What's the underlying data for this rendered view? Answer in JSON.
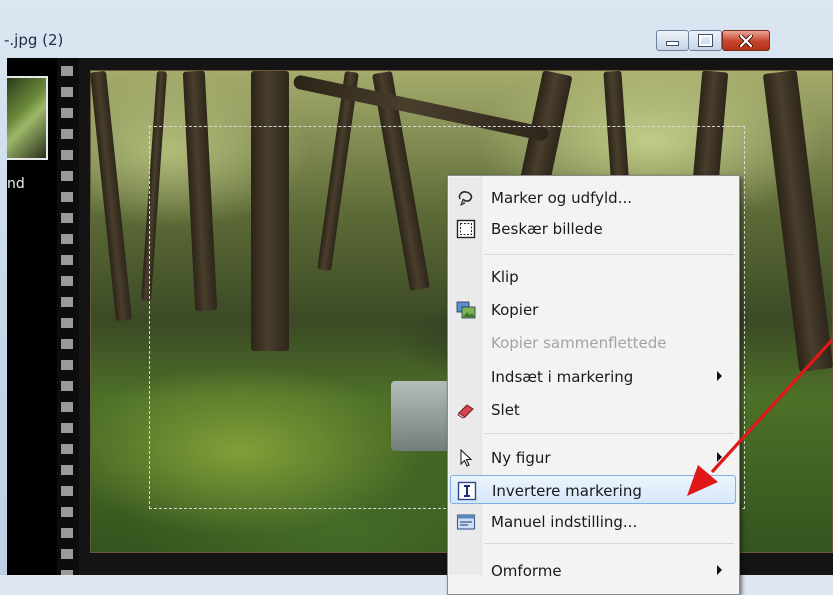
{
  "window": {
    "title": "-.jpg (2)",
    "buttons": {
      "minimize": "minimize",
      "maximize": "maximize",
      "close": "close"
    }
  },
  "thumbnail": {
    "label": "nd"
  },
  "context_menu": {
    "items": [
      {
        "label": "Marker og udfyld...",
        "icon": "lasso-icon",
        "enabled": true
      },
      {
        "label": "Beskær billede",
        "icon": "crop-icon",
        "enabled": true
      },
      {
        "separator": true
      },
      {
        "label": "Klip",
        "icon": "",
        "enabled": true
      },
      {
        "label": "Kopier",
        "icon": "copy-image-icon",
        "enabled": true
      },
      {
        "label": "Kopier sammenflettede",
        "icon": "",
        "enabled": false
      },
      {
        "label": "Indsæt i markering",
        "icon": "",
        "enabled": true,
        "submenu": true
      },
      {
        "label": "Slet",
        "icon": "eraser-icon",
        "enabled": true
      },
      {
        "separator": true
      },
      {
        "label": "Ny figur",
        "icon": "pointer-icon",
        "enabled": true,
        "submenu": true
      },
      {
        "label": "Invertere markering",
        "icon": "invert-selection-icon",
        "enabled": true,
        "highlighted": true
      },
      {
        "label": "Manuel indstilling...",
        "icon": "manual-settings-icon",
        "enabled": true
      },
      {
        "separator": true
      },
      {
        "label": "Omforme",
        "icon": "",
        "enabled": true,
        "submenu": true
      }
    ]
  },
  "colors": {
    "arrow": "#e01818",
    "highlight": "#d6e7fb",
    "close_button": "#c6442d"
  }
}
